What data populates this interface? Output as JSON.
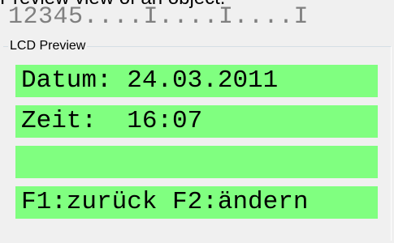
{
  "caption": "Preview view of an object.",
  "ruler": "12345....I....I....I",
  "group_title": "LCD Preview",
  "lcd": {
    "lines": [
      "Datum: 24.03.2011",
      "Zeit:  16:07",
      "",
      "F1:zurück F2:ändern"
    ],
    "background_color": "#80ff80"
  }
}
